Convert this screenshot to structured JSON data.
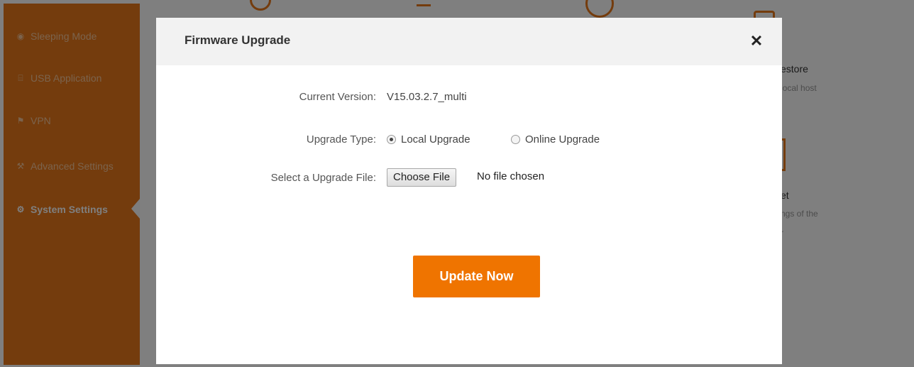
{
  "sidebar": {
    "items": [
      {
        "label": "Sleeping Mode",
        "icon": "bulb-icon",
        "glyph": "◉"
      },
      {
        "label": "USB Application",
        "icon": "usb-icon",
        "glyph": "⌸"
      },
      {
        "label": "VPN",
        "icon": "vpn-icon",
        "glyph": "⚑"
      },
      {
        "label": "Advanced Settings",
        "icon": "wrench-icon",
        "glyph": "⚒"
      },
      {
        "label": "System Settings",
        "icon": "gear-icon",
        "glyph": "⚙",
        "active": true
      }
    ]
  },
  "background": {
    "restore_title_fragment": "estore",
    "restore_sub_fragment": "local host",
    "reset_title_fragment": "et",
    "reset_sub_fragment_1": "ngs of the",
    "reset_sub_fragment_2": "r"
  },
  "dialog": {
    "title": "Firmware Upgrade",
    "close_glyph": "✕",
    "current_version_label": "Current Version:",
    "current_version_value": "V15.03.2.7_multi",
    "upgrade_type_label": "Upgrade Type:",
    "upgrade_options": [
      {
        "label": "Local Upgrade",
        "checked": true
      },
      {
        "label": "Online Upgrade",
        "checked": false
      }
    ],
    "file_label": "Select a Upgrade File:",
    "choose_file_label": "Choose File",
    "file_status": "No file chosen",
    "update_button": "Update Now"
  },
  "colors": {
    "accent": "#ef7400",
    "sidebar": "#e8781b",
    "overlay": "rgba(0,0,0,0.5)"
  }
}
